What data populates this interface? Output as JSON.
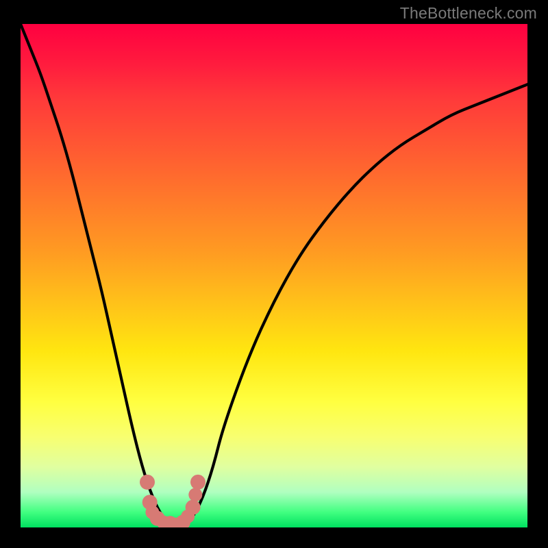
{
  "watermark": "TheBottleneck.com",
  "chart_data": {
    "type": "line",
    "title": "",
    "xlabel": "",
    "ylabel": "",
    "xlim": [
      0,
      100
    ],
    "ylim": [
      0,
      100
    ],
    "series": [
      {
        "name": "bottleneck-curve",
        "x": [
          0,
          2,
          4,
          6,
          8,
          10,
          12,
          14,
          16,
          18,
          20,
          22,
          24,
          26,
          28,
          30,
          32,
          34,
          36,
          38,
          40,
          45,
          50,
          55,
          60,
          65,
          70,
          75,
          80,
          85,
          90,
          95,
          100
        ],
        "values": [
          100,
          95,
          90,
          84,
          78,
          71,
          63,
          55,
          47,
          38,
          29,
          20,
          12,
          6,
          2,
          0,
          0,
          2,
          6,
          12,
          20,
          34,
          45,
          54,
          61,
          67,
          72,
          76,
          79,
          82,
          84,
          86,
          88
        ]
      }
    ],
    "markers": [
      {
        "name": "marker-left-top",
        "x": 25.0,
        "y": 9.0
      },
      {
        "name": "marker-left-mid",
        "x": 25.5,
        "y": 5.0
      },
      {
        "name": "marker-bottom-1",
        "x": 27.0,
        "y": 1.8
      },
      {
        "name": "marker-bottom-2",
        "x": 29.5,
        "y": 0.8
      },
      {
        "name": "marker-bottom-3",
        "x": 32.0,
        "y": 1.0
      },
      {
        "name": "marker-right-mid",
        "x": 34.0,
        "y": 4.0
      },
      {
        "name": "marker-right-top",
        "x": 35.0,
        "y": 9.0
      }
    ],
    "marker_color": "#d77a74",
    "grid": false,
    "legend": false
  }
}
